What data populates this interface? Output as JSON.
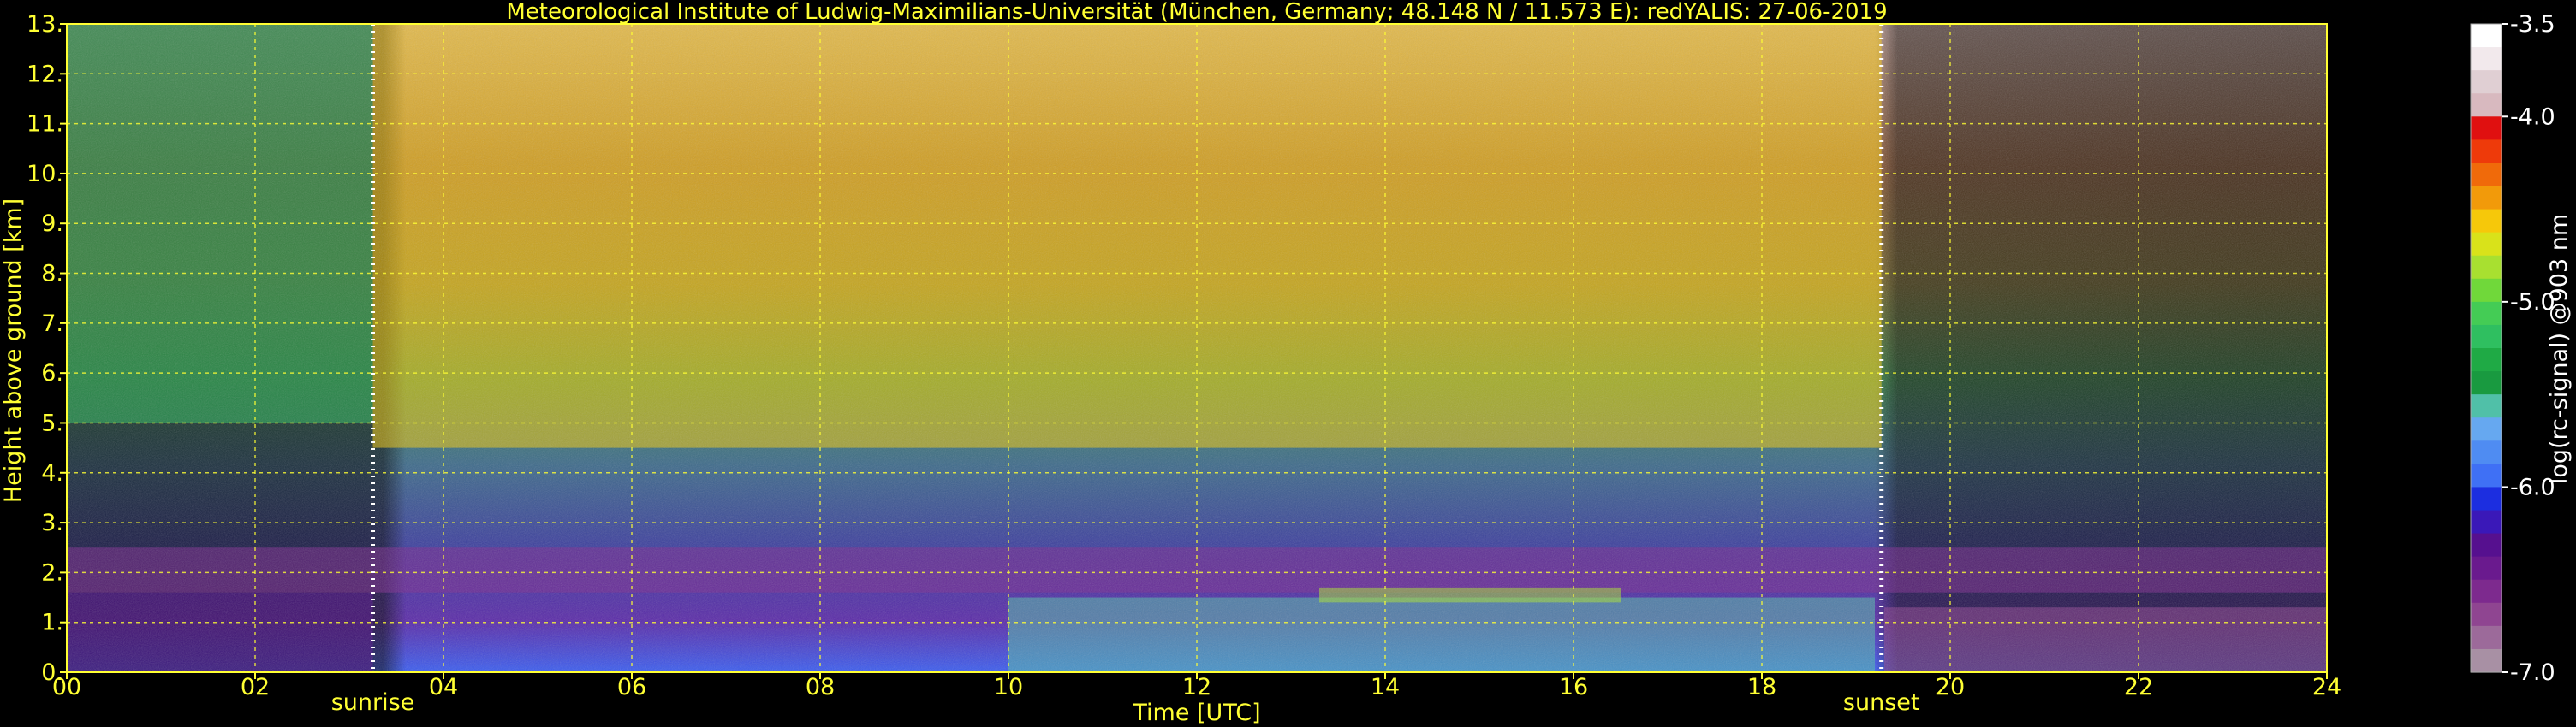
{
  "chart_data": {
    "type": "heatmap",
    "title": "Meteorological Institute of Ludwig-Maximilians-Universität (München, Germany; 48.148 N / 11.573 E):    redYALIS: 27-06-2019",
    "xlabel": "Time [UTC]",
    "ylabel": "Height above ground [km]",
    "xlim": [
      0,
      24
    ],
    "ylim": [
      0,
      13
    ],
    "x_ticks": [
      "00",
      "02",
      "04",
      "06",
      "08",
      "10",
      "12",
      "14",
      "16",
      "18",
      "20",
      "22",
      "24"
    ],
    "y_ticks": [
      "0.",
      "1.",
      "2.",
      "3.",
      "4.",
      "5.",
      "6.",
      "7.",
      "8.",
      "9.",
      "10.",
      "11.",
      "12.",
      "13."
    ],
    "grid": true,
    "markers": [
      {
        "label": "sunrise",
        "x": 3.25
      },
      {
        "label": "sunset",
        "x": 19.27
      }
    ],
    "colorbar": {
      "label": "log(rc-signal) @903 nm",
      "range": [
        -7.0,
        -3.5
      ],
      "ticks": [
        "-3.5",
        "-4.0",
        "-5.0",
        "-6.0",
        "-7.0"
      ],
      "colors": [
        "#ffffff",
        "#f2e9ec",
        "#e0cfd3",
        "#d8b9bf",
        "#e01010",
        "#ee3a0a",
        "#f06a0a",
        "#f29a0a",
        "#f6c80a",
        "#d9e21a",
        "#a8e030",
        "#70d83a",
        "#44cc55",
        "#2fbf60",
        "#1faa45",
        "#199a40",
        "#50c0a8",
        "#66a8f0",
        "#4f8cf2",
        "#3f70f5",
        "#1c2ee0",
        "#3a18b8",
        "#56108f",
        "#6a1a8e",
        "#7d2a8e",
        "#8f4591",
        "#9c6a9a",
        "#a890a4"
      ]
    },
    "regions": [
      {
        "x": [
          0,
          3.25
        ],
        "y": [
          0,
          1.6
        ],
        "level": -6.3
      },
      {
        "x": [
          0,
          24
        ],
        "y": [
          1.6,
          2.5
        ],
        "level": -6.6
      },
      {
        "x": [
          10,
          19.2
        ],
        "y": [
          0,
          1.5
        ],
        "level": -5.6
      },
      {
        "x": [
          13.3,
          16.5
        ],
        "y": [
          1.4,
          1.7
        ],
        "level": -4.8
      },
      {
        "x": [
          19.3,
          24
        ],
        "y": [
          0,
          1.3
        ],
        "level": -6.7
      },
      {
        "x": [
          3.25,
          19.27
        ],
        "y": [
          4.5,
          13
        ],
        "level": -4.6
      },
      {
        "x": [
          0,
          3.25
        ],
        "y": [
          5,
          13
        ],
        "level": -5.2
      }
    ]
  }
}
